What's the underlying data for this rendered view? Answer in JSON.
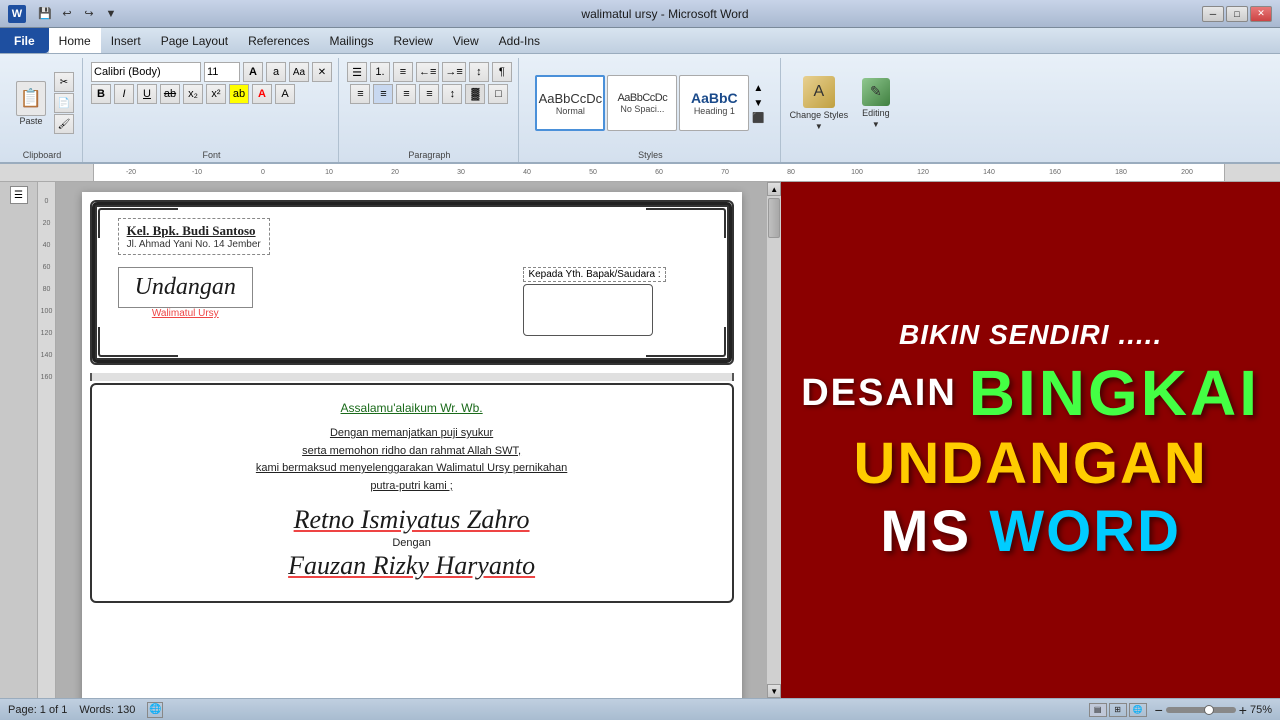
{
  "titlebar": {
    "title": "walimatul ursy - Microsoft Word",
    "word_icon": "W",
    "min_btn": "─",
    "max_btn": "□",
    "close_btn": "✕"
  },
  "menu": {
    "file": "File",
    "home": "Home",
    "insert": "Insert",
    "page_layout": "Page Layout",
    "references": "References",
    "mailings": "Mailings",
    "review": "Review",
    "view": "View",
    "add_ins": "Add-Ins"
  },
  "ribbon": {
    "clipboard_label": "Clipboard",
    "paste_label": "Paste",
    "font_label": "Font",
    "font_name": "Calibri (Body)",
    "font_size": "11",
    "paragraph_label": "Paragraph",
    "styles_label": "Styles",
    "style_normal": "Normal",
    "style_nospace": "No Spaci...",
    "style_heading": "Heading 1",
    "change_styles": "Change Styles",
    "editing": "Editing"
  },
  "status": {
    "page": "Page: 1 of 1",
    "words": "Words: 130",
    "zoom": "75%"
  },
  "document": {
    "sender_name": "Kel. Bpk. Budi Santoso",
    "sender_address": "Jl. Ahmad Yani No. 14 Jember",
    "kepada": "Kepada Yth. Bapak/Saudara :",
    "undangan": "Undangan",
    "walimatul": "Walimatul Ursy",
    "assalamu": "Assalamu'alaikum Wr. Wb.",
    "body1": "Dengan memanjatkan puji syukur",
    "body2": "serta memohon ridho dan rahmat Allah SWT,",
    "body3": "kami bermaksud menyelenggarakan Walimatul Ursy pernikahan",
    "body4": "putra-putri kami ;",
    "bride": "Retno Ismiyatus Zahro",
    "dengan": "Dengan",
    "groom": "Fauzan Rizky Haryanto"
  },
  "promo": {
    "line1": "BIKIN SENDIRI .....",
    "desain": "DESAIN",
    "bingkai": "BINGKAI",
    "undangan": "UNDANGAN",
    "ms": "MS ",
    "word": "WORD"
  },
  "colors": {
    "dark_red": "#8B0000",
    "green": "#44ff44",
    "yellow": "#ffcc00",
    "cyan": "#00ccff",
    "white": "#ffffff"
  }
}
